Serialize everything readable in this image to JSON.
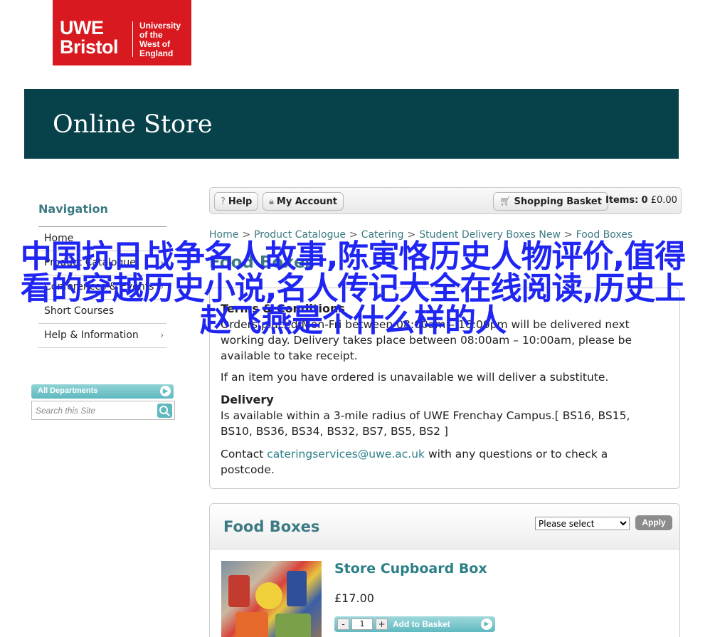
{
  "logo": {
    "line1": "UWE",
    "line2": "Bristol",
    "small1": "University",
    "small2": "of the",
    "small3": "West of",
    "small4": "England"
  },
  "banner": {
    "title": "Online Store"
  },
  "nav": {
    "title": "Navigation",
    "items": [
      {
        "label": "Home"
      },
      {
        "label": "Product Catalogue"
      },
      {
        "label": "Conferences & Events"
      },
      {
        "label": "Short Courses"
      },
      {
        "label": "Help & Information"
      }
    ]
  },
  "departments": {
    "label": "All Departments",
    "search_placeholder": "Search this Site"
  },
  "toolbar": {
    "help": "Help",
    "account": "My Account",
    "basket": "Shopping Basket",
    "items_label": "Items:",
    "items_count": "0",
    "items_total": "£0.00"
  },
  "breadcrumb": [
    "Home",
    "Product Catalogue",
    "Catering",
    "Student Delivery Boxes New",
    "Food Boxes"
  ],
  "page_title": "Food Boxes",
  "info": {
    "terms_heading": "Terms & Conditions",
    "terms_text": "Orders placed Mon-Fri between 08:00am – 16:00pm will be delivered next working day. Delivery takes place between 08:00am – 10:00am, please be available to take receipt.",
    "substitute": "If an item you have ordered is unavailable we will deliver a substitute.",
    "delivery_heading": "Delivery",
    "delivery_text": "Is available within a 3-mile radius of UWE Frenchay Campus.[ BS16, BS15, BS10, BS36, BS34, BS32, BS7, BS5, BS2 ]",
    "contact_pre": "Contact ",
    "contact_email": "cateringservices@uwe.ac.uk",
    "contact_post": " with any questions or to check a postcode."
  },
  "food_boxes": {
    "heading": "Food Boxes",
    "sort_selected": "Please select",
    "apply": "Apply",
    "product": {
      "name": "Store Cupboard Box",
      "price": "£17.00",
      "qty": "1",
      "add_label": "Add to Basket"
    }
  },
  "overlay_text": "中国抗日战争名人故事,陈寅恪历史人物评价,值得看的穿越历史小说,名人传记大全在线阅读,历史上赵飞燕是个什么样的人",
  "colors": {
    "brand_red": "#d81a20",
    "banner": "#07414a",
    "teal": "#3c7a83",
    "overlay": "#1f25f2"
  }
}
